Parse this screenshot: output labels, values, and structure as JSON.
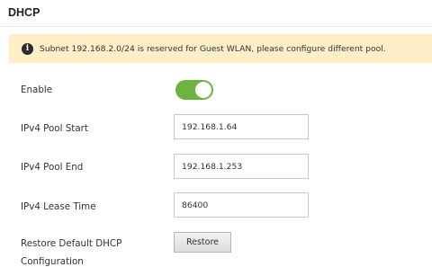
{
  "page": {
    "title": "DHCP"
  },
  "alert": {
    "icon": "info-icon",
    "message": "Subnet 192.168.2.0/24 is reserved for Guest WLAN, please configure different pool."
  },
  "form": {
    "enable_label": "Enable",
    "enable_state": true,
    "pool_start_label": "IPv4 Pool Start",
    "pool_start_value": "192.168.1.64",
    "pool_end_label": "IPv4 Pool End",
    "pool_end_value": "192.168.1.253",
    "lease_time_label": "IPv4 Lease Time",
    "lease_time_value": "86400",
    "restore_label_line1": "Restore Default DHCP",
    "restore_label_line2": "Configuration",
    "restore_button": "Restore"
  },
  "colors": {
    "toggle_on": "#6db33f",
    "alert_background": "#fcefc8"
  }
}
